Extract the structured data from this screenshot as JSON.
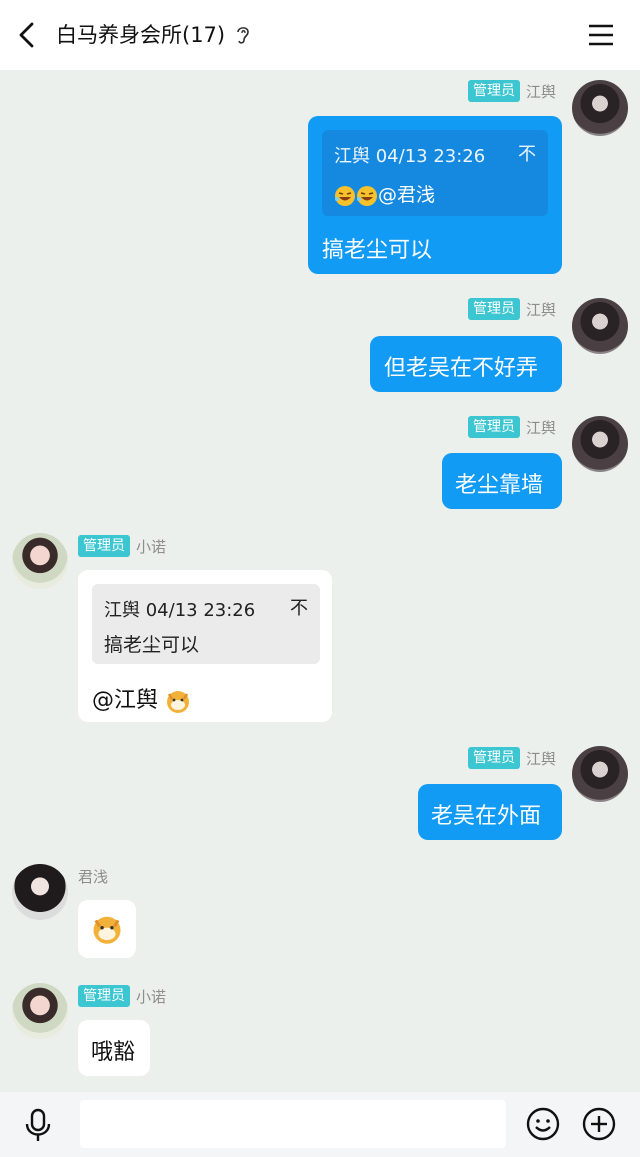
{
  "header": {
    "title": "白马养身会所(17)"
  },
  "colors": {
    "accent": "#129bf5",
    "badge": "#3cc6d2",
    "background": "#ebf0ec"
  },
  "messages": [
    {
      "side": "right",
      "badge": "管理员",
      "name": "江舆",
      "quote": {
        "head": "江舆 04/13 23:26",
        "pin": "不",
        "body": "@君浅"
      },
      "text": "搞老尘可以"
    },
    {
      "side": "right",
      "badge": "管理员",
      "name": "江舆",
      "text": "但老吴在不好弄"
    },
    {
      "side": "right",
      "badge": "管理员",
      "name": "江舆",
      "text": "老尘靠墙"
    },
    {
      "side": "left",
      "badge": "管理员",
      "name": "小诺",
      "quote": {
        "head": "江舆 04/13 23:26",
        "pin": "不",
        "body": "搞老尘可以"
      },
      "text": "@江舆"
    },
    {
      "side": "right",
      "badge": "管理员",
      "name": "江舆",
      "text": "老吴在外面"
    },
    {
      "side": "left",
      "name": "君浅",
      "sticker": "doge-emoji"
    },
    {
      "side": "left",
      "badge": "管理员",
      "name": "小诺",
      "text": "哦豁"
    }
  ],
  "footer": {
    "input_placeholder": ""
  }
}
